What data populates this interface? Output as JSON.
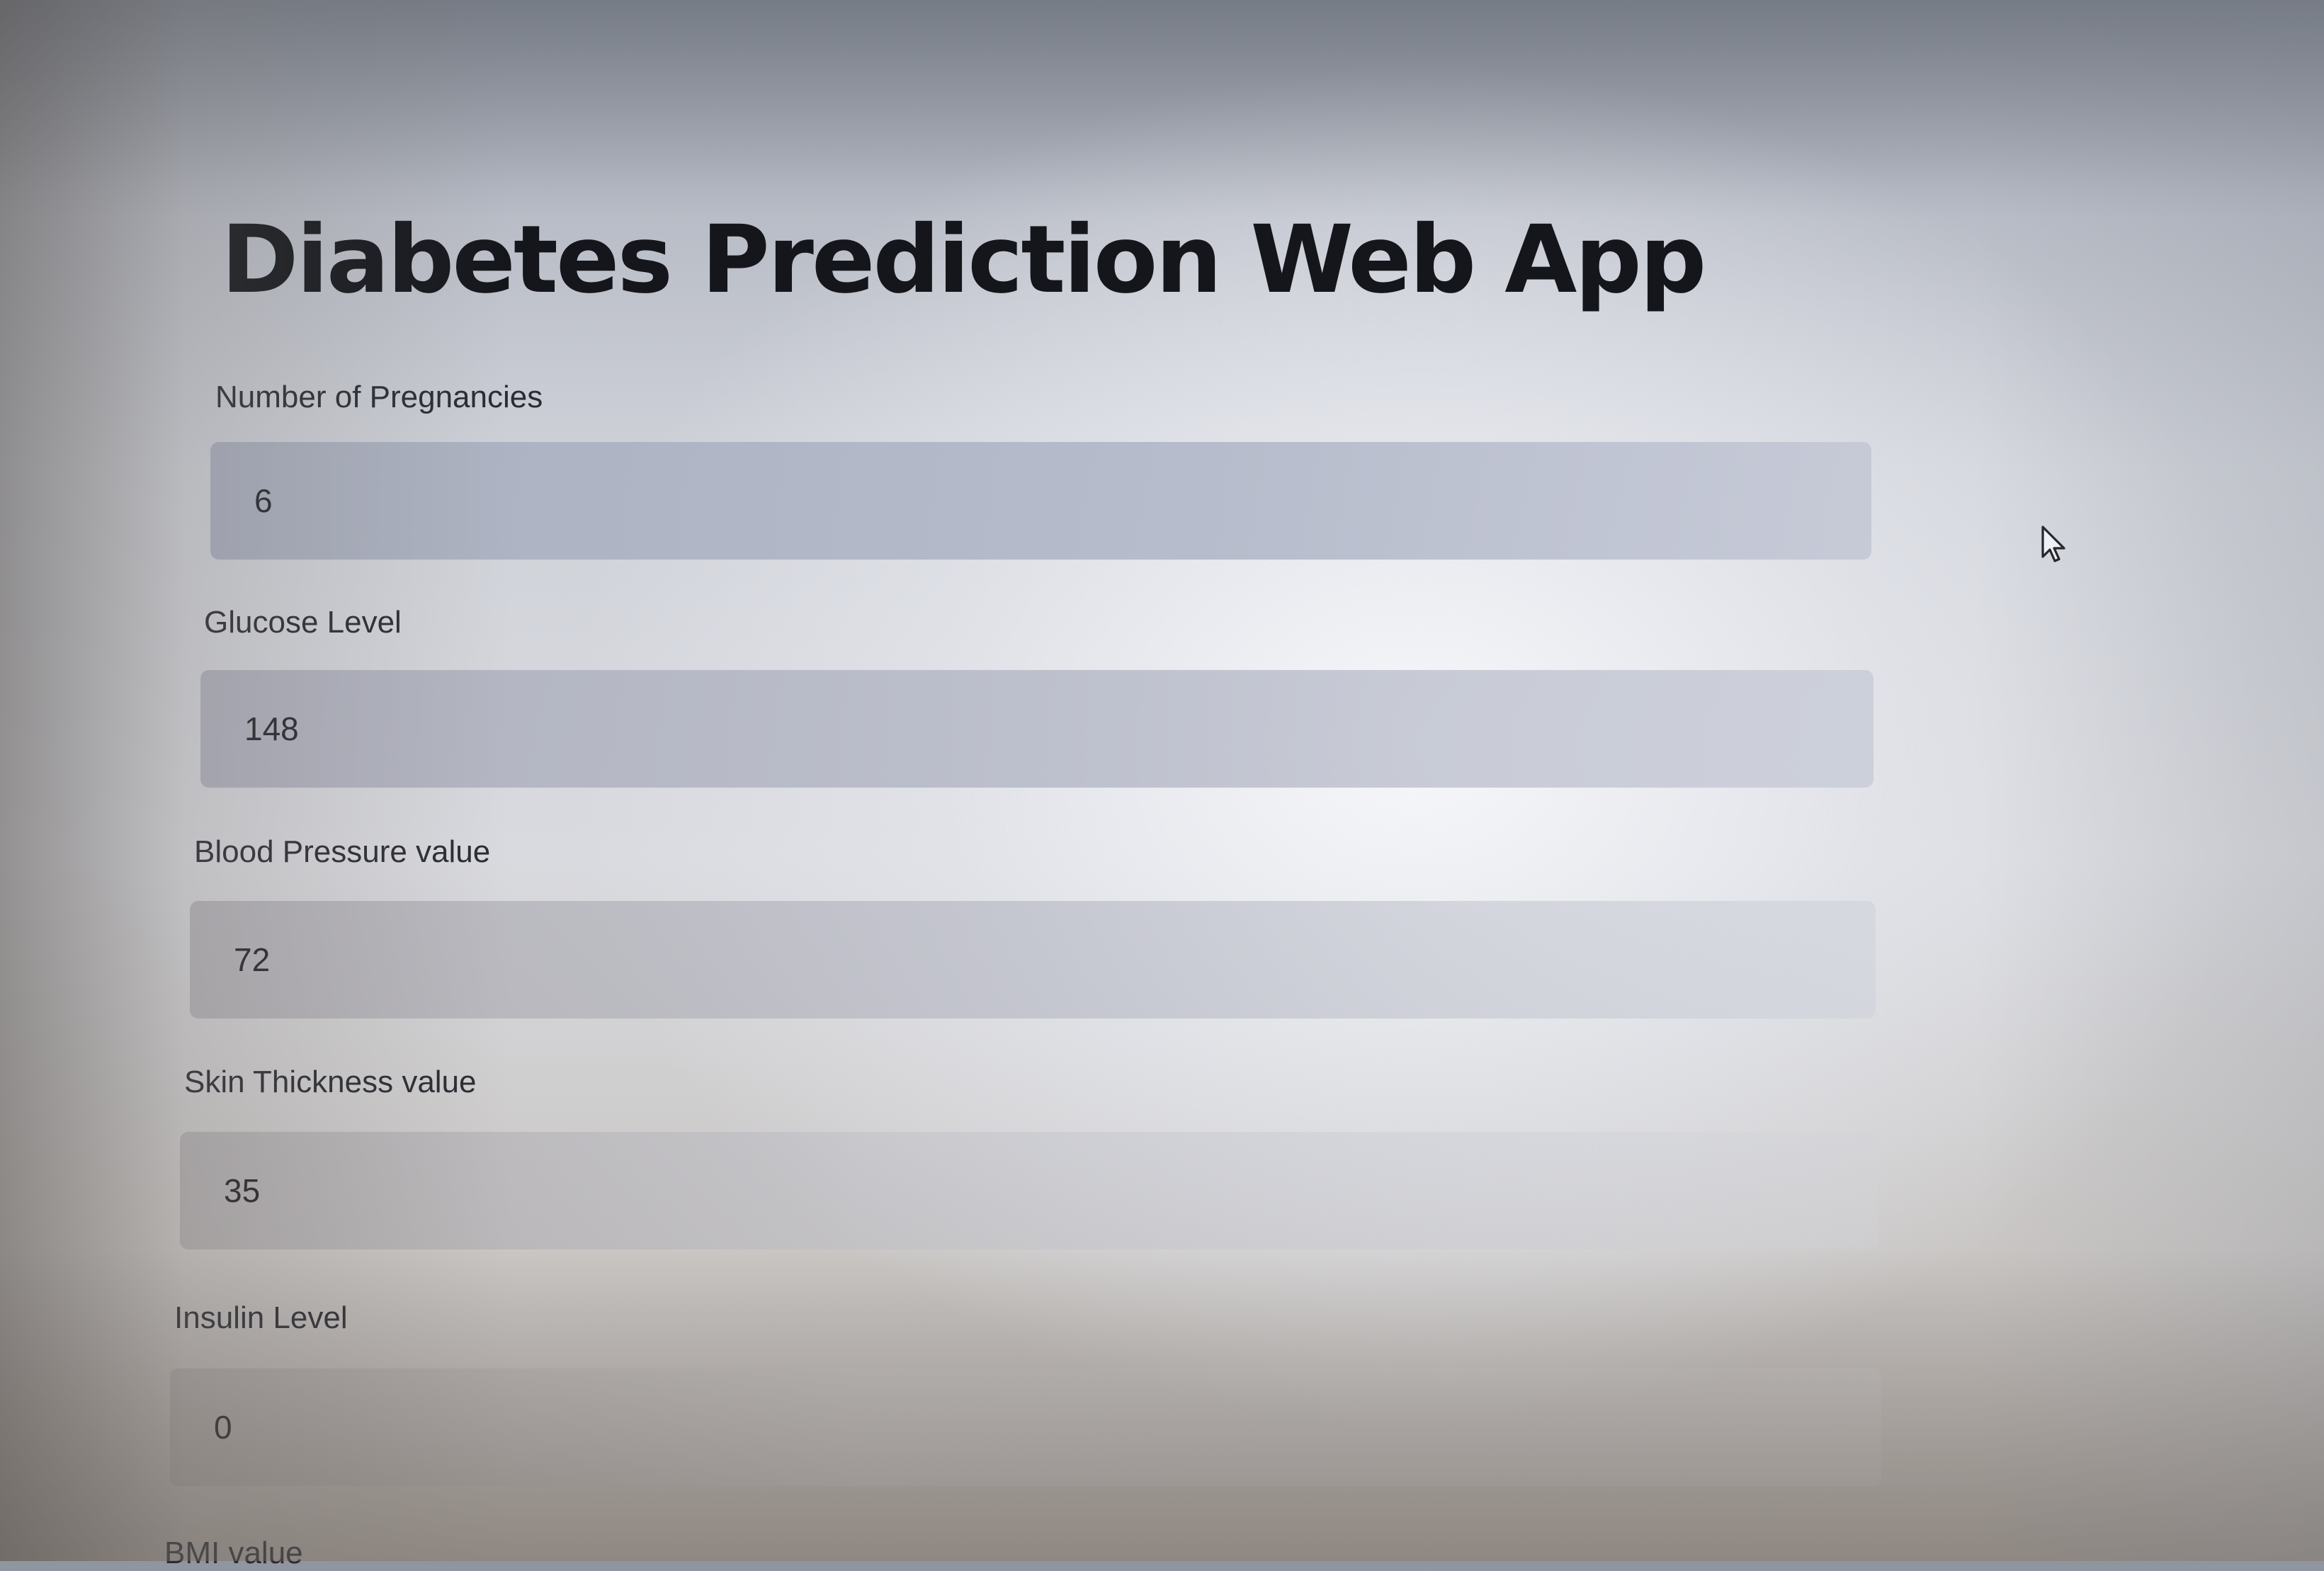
{
  "app": {
    "title": "Diabetes Prediction Web App"
  },
  "form": {
    "fields": [
      {
        "label": "Number of Pregnancies",
        "value": "6"
      },
      {
        "label": "Glucose Level",
        "value": "148"
      },
      {
        "label": "Blood Pressure value",
        "value": "72"
      },
      {
        "label": "Skin Thickness value",
        "value": "35"
      },
      {
        "label": "Insulin Level",
        "value": "0"
      },
      {
        "label": "BMI value",
        "value": ""
      }
    ]
  },
  "colors": {
    "input_background": "#b4bac9",
    "title_text": "#14161c"
  },
  "icons": {
    "cursor": "mouse-pointer-icon"
  }
}
